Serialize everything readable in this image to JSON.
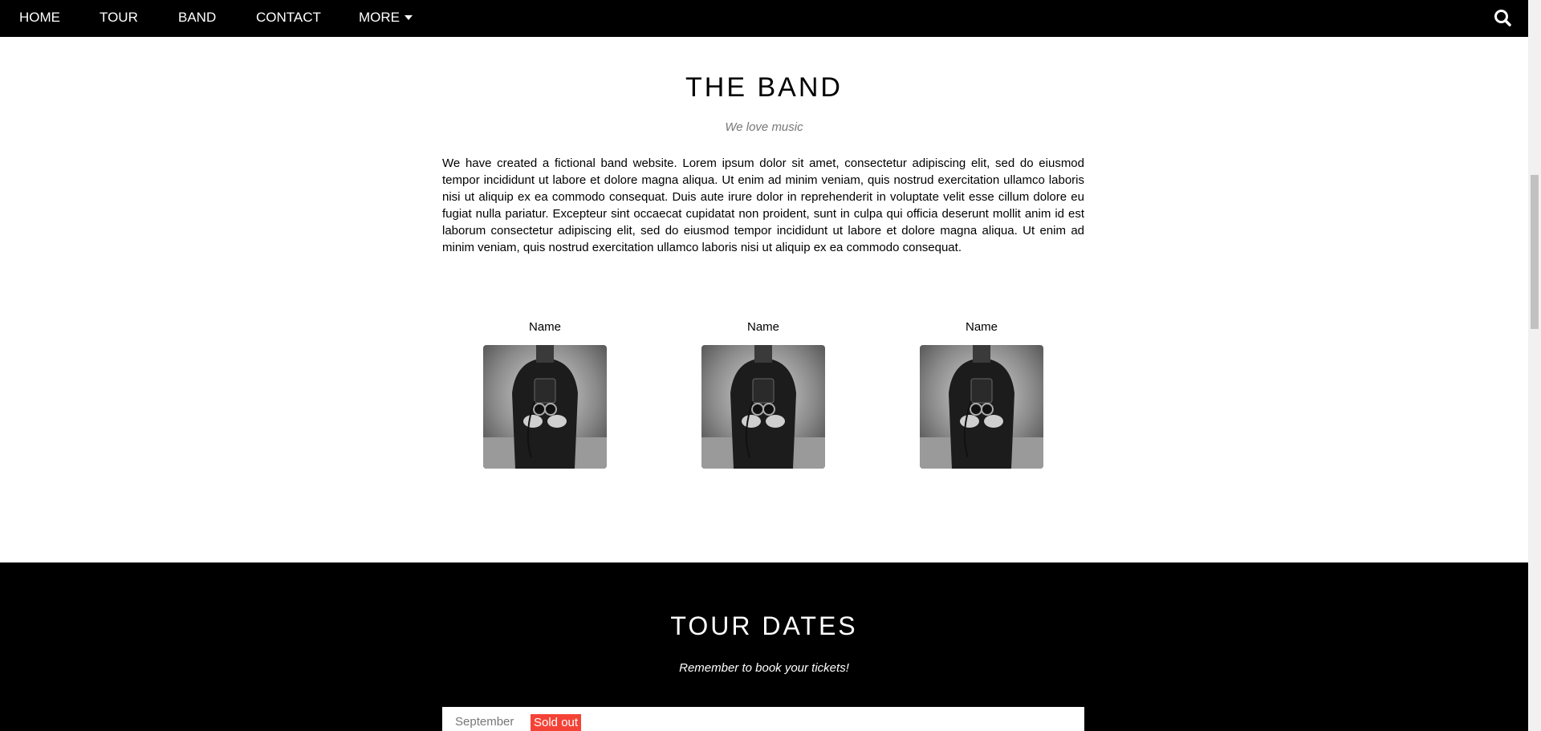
{
  "navbar": {
    "items": [
      {
        "label": "HOME"
      },
      {
        "label": "TOUR"
      },
      {
        "label": "BAND"
      },
      {
        "label": "CONTACT"
      },
      {
        "label": "MORE"
      }
    ],
    "search_icon": "search-icon",
    "more_icon": "caret-down-icon",
    "background": "#000000"
  },
  "band": {
    "title": "THE BAND",
    "subtitle": "We love music",
    "description": "We have created a fictional band website. Lorem ipsum dolor sit amet, consectetur adipiscing elit, sed do eiusmod tempor incididunt ut labore et dolore magna aliqua. Ut enim ad minim veniam, quis nostrud exercitation ullamco laboris nisi ut aliquip ex ea commodo consequat. Duis aute irure dolor in reprehenderit in voluptate velit esse cillum dolore eu fugiat nulla pariatur. Excepteur sint occaecat cupidatat non proident, sunt in culpa qui officia deserunt mollit anim id est laborum consectetur adipiscing elit, sed do eiusmod tempor incididunt ut labore et dolore magna aliqua. Ut enim ad minim veniam, quis nostrud exercitation ullamco laboris nisi ut aliquip ex ea commodo consequat.",
    "members": [
      {
        "name": "Name"
      },
      {
        "name": "Name"
      },
      {
        "name": "Name"
      }
    ]
  },
  "tour": {
    "title": "TOUR DATES",
    "subtitle": "Remember to book your tickets!",
    "tickets": [
      {
        "month": "September",
        "badge": "Sold out",
        "badge_color": "#f44336"
      }
    ],
    "background": "#000000"
  }
}
